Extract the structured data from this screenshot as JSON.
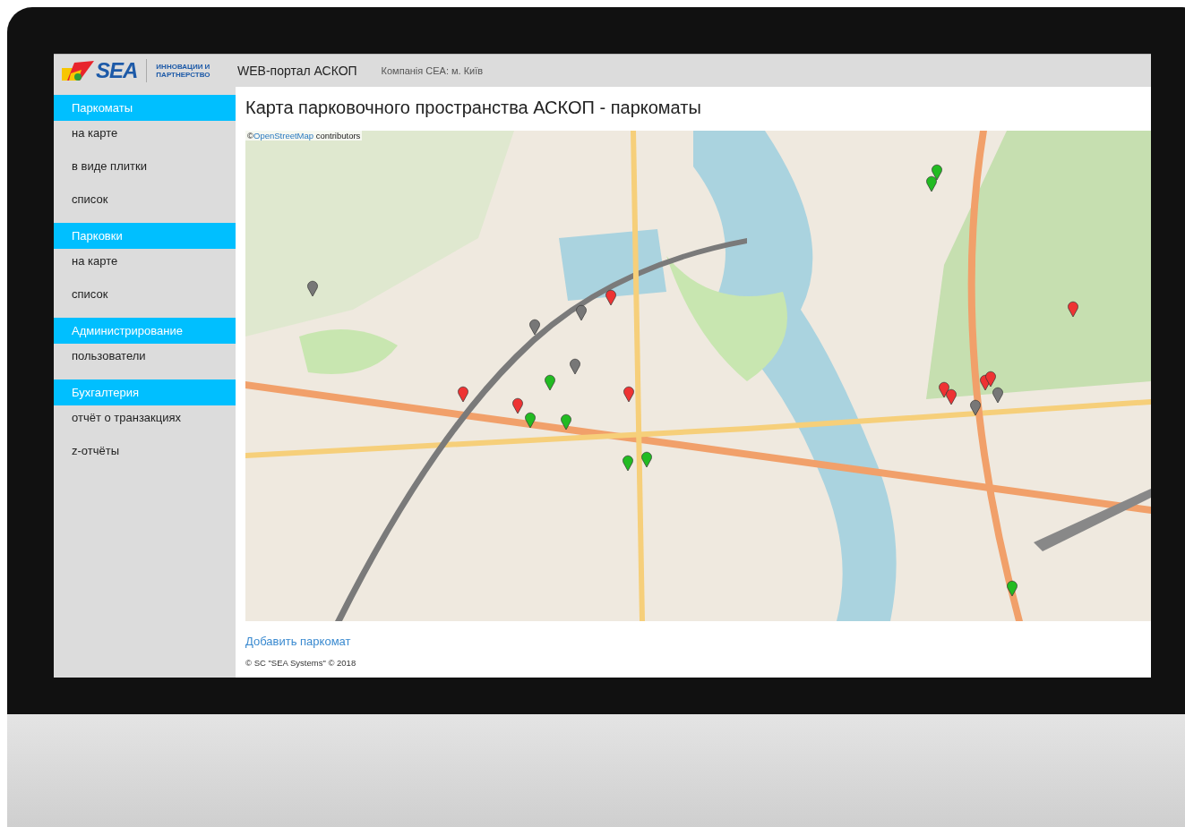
{
  "header": {
    "logo_text": "SEA",
    "logo_tagline": [
      "ИННОВАЦИИ И",
      "ПАРТНЕРСТВО"
    ],
    "portal_title": "WEB-портал АСКОП",
    "company": "Компанія СЕА: м. Київ"
  },
  "sidebar": {
    "sections": [
      {
        "title": "Паркоматы",
        "items": [
          "на карте",
          "в виде плитки",
          "список"
        ]
      },
      {
        "title": "Парковки",
        "items": [
          "на карте",
          "список"
        ]
      },
      {
        "title": "Администрирование",
        "items": [
          "пользователи"
        ]
      },
      {
        "title": "Бухгалтерия",
        "items": [
          "отчёт о транзакциях",
          "z-отчёты"
        ]
      }
    ]
  },
  "content": {
    "title": "Карта парковочного пространства АСКОП - паркоматы",
    "map": {
      "attribution": {
        "prefix": "©",
        "link": "OpenStreetMap",
        "suffix": "contributors"
      }
    },
    "add_link": "Добавить паркомат",
    "footer": "© SC \"SEA Systems\" © 2018"
  }
}
